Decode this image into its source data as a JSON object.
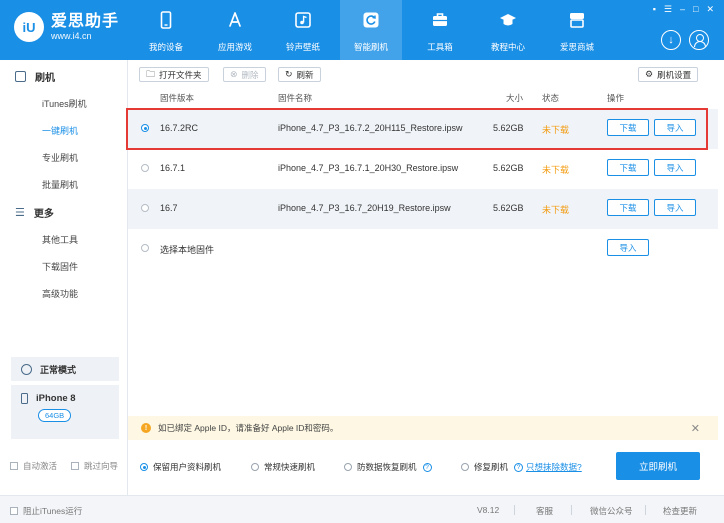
{
  "window_controls": [
    "▪",
    "☰",
    "–",
    "□",
    "✕"
  ],
  "logo": {
    "badge": "iU",
    "name": "爱思助手",
    "url": "www.i4.cn"
  },
  "nav": [
    {
      "label": "我的设备",
      "icon": "phone-icon"
    },
    {
      "label": "应用游戏",
      "icon": "appstore-icon"
    },
    {
      "label": "铃声壁纸",
      "icon": "music-icon"
    },
    {
      "label": "智能刷机",
      "icon": "refresh-icon",
      "active": true
    },
    {
      "label": "工具箱",
      "icon": "toolbox-icon"
    },
    {
      "label": "教程中心",
      "icon": "graduation-cap-icon"
    },
    {
      "label": "爱思商城",
      "icon": "store-icon"
    }
  ],
  "sidebar": {
    "section1": "刷机",
    "items1": [
      "iTunes刷机",
      "一键刷机",
      "专业刷机",
      "批量刷机"
    ],
    "active_item": "一键刷机",
    "section2": "更多",
    "items2": [
      "其他工具",
      "下载固件",
      "高级功能"
    ],
    "mode": "正常模式",
    "device_name": "iPhone 8",
    "device_capacity": "64GB"
  },
  "toolbar": {
    "open_folder": "打开文件夹",
    "delete": "删除",
    "refresh": "刷新",
    "settings": "刷机设置"
  },
  "table": {
    "headers": {
      "version": "固件版本",
      "name": "固件名称",
      "size": "大小",
      "status": "状态",
      "action": "操作"
    },
    "rows": [
      {
        "version": "16.7.2RC",
        "name": "iPhone_4.7_P3_16.7.2_20H115_Restore.ipsw",
        "size": "5.62GB",
        "status": "未下载",
        "download": "下载",
        "import": "导入",
        "selected": true
      },
      {
        "version": "16.7.1",
        "name": "iPhone_4.7_P3_16.7.1_20H30_Restore.ipsw",
        "size": "5.62GB",
        "status": "未下载",
        "download": "下载",
        "import": "导入",
        "selected": false
      },
      {
        "version": "16.7",
        "name": "iPhone_4.7_P3_16.7_20H19_Restore.ipsw",
        "size": "5.62GB",
        "status": "未下载",
        "download": "下载",
        "import": "导入",
        "selected": false
      }
    ],
    "local_row": {
      "label": "选择本地固件",
      "import": "导入"
    }
  },
  "notice": {
    "text": "如已绑定 Apple ID，请准备好 Apple ID和密码。"
  },
  "options": {
    "keep_data": "保留用户资料刷机",
    "quick": "常规快速刷机",
    "anti_recovery": "防数据恢复刷机",
    "repair": "修复刷机",
    "erase_link": "只想抹除数据?",
    "flash_now": "立即刷机"
  },
  "side_options": {
    "auto_activate": "自动激活",
    "skip_guide": "跳过向导"
  },
  "statusbar": {
    "block_itunes": "阻止iTunes运行",
    "version": "V8.12",
    "service": "客服",
    "wechat": "微信公众号",
    "update": "检查更新"
  },
  "colors": {
    "brand": "#1a8fe6",
    "status_not_downloaded": "#f39c12",
    "highlight": "#e53935",
    "notice_bg": "#fdf7e3"
  }
}
